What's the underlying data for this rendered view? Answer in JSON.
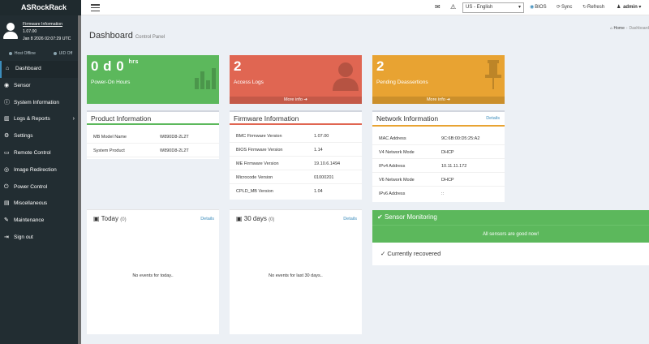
{
  "brand": "ASRockRack",
  "user": {
    "fw_label": "Firmware Information",
    "version": "1.07.00",
    "datetime": "Jan 8 2026 02:07:29 UTC"
  },
  "status": {
    "host": "Host Offline",
    "uid": "UID Off"
  },
  "menu": [
    {
      "label": "Dashboard",
      "icon": "dashboard-icon",
      "glyph": "⌂"
    },
    {
      "label": "Sensor",
      "icon": "gauge-icon",
      "glyph": "◉"
    },
    {
      "label": "System Information",
      "icon": "info-icon",
      "glyph": "ⓘ"
    },
    {
      "label": "Logs & Reports",
      "icon": "chart-icon",
      "glyph": "▥"
    },
    {
      "label": "Settings",
      "icon": "gear-icon",
      "glyph": "⚙"
    },
    {
      "label": "Remote Control",
      "icon": "monitor-icon",
      "glyph": "▭"
    },
    {
      "label": "Image Redirection",
      "icon": "disc-icon",
      "glyph": "◎"
    },
    {
      "label": "Power Control",
      "icon": "power-icon",
      "glyph": "⏻"
    },
    {
      "label": "Miscellaneous",
      "icon": "box-icon",
      "glyph": "▤"
    },
    {
      "label": "Maintenance",
      "icon": "wrench-icon",
      "glyph": "✎"
    },
    {
      "label": "Sign out",
      "icon": "signout-icon",
      "glyph": "⇥"
    }
  ],
  "topbar": {
    "language": "US - English",
    "bios": "BIOS",
    "sync": "Sync",
    "refresh": "Refresh",
    "user": "admin"
  },
  "page": {
    "title": "Dashboard",
    "subtitle": "Control Panel"
  },
  "breadcrumb": {
    "home": "Home",
    "current": "Dashboard"
  },
  "boxes": {
    "power": {
      "value": "0 d 0",
      "unit": "hrs",
      "label": "Power-On Hours"
    },
    "access": {
      "value": "2",
      "label": "Access Logs",
      "more": "More info"
    },
    "deassert": {
      "value": "2",
      "label": "Pending Deassertions",
      "more": "More info"
    }
  },
  "product": {
    "title": "Product Information",
    "rows": [
      {
        "k": "MB Model Name",
        "v": "W890D8-2L2T"
      },
      {
        "k": "System Product",
        "v": "W890D8-2L2T"
      }
    ]
  },
  "firmware": {
    "title": "Firmware Information",
    "rows": [
      {
        "k": "BMC Firmware Version",
        "v": "1.07.00"
      },
      {
        "k": "BIOS Firmware Version",
        "v": "1.14"
      },
      {
        "k": "ME Firmware Version",
        "v": "19.10.6.1494"
      },
      {
        "k": "Microcode Version",
        "v": "01000201"
      },
      {
        "k": "CPLD_MB Version",
        "v": "1.04"
      }
    ]
  },
  "network": {
    "title": "Network Information",
    "details": "Details",
    "rows": [
      {
        "k": "MAC Address",
        "v": "9C:6B:00:D5:25:A2"
      },
      {
        "k": "V4 Network Mode",
        "v": "DHCP"
      },
      {
        "k": "IPv4 Address",
        "v": "10.11.11.172"
      },
      {
        "k": "V6 Network Mode",
        "v": "DHCP"
      },
      {
        "k": "IPv6 Address",
        "v": "::"
      }
    ]
  },
  "today": {
    "title": "Today",
    "count": "(0)",
    "details": "Details",
    "empty": "No events for today.."
  },
  "days30": {
    "title": "30 days",
    "count": "(0)",
    "details": "Details",
    "empty": "No events for last 30 days.."
  },
  "sensor": {
    "title": "Sensor Monitoring",
    "message": "All sensors are good now!",
    "recovered": "Currently recovered"
  },
  "colors": {
    "green": "#5cb85c",
    "red": "#e06652",
    "orange": "#e8a332",
    "sidebar": "#222d32",
    "accent": "#3c8dbc"
  }
}
